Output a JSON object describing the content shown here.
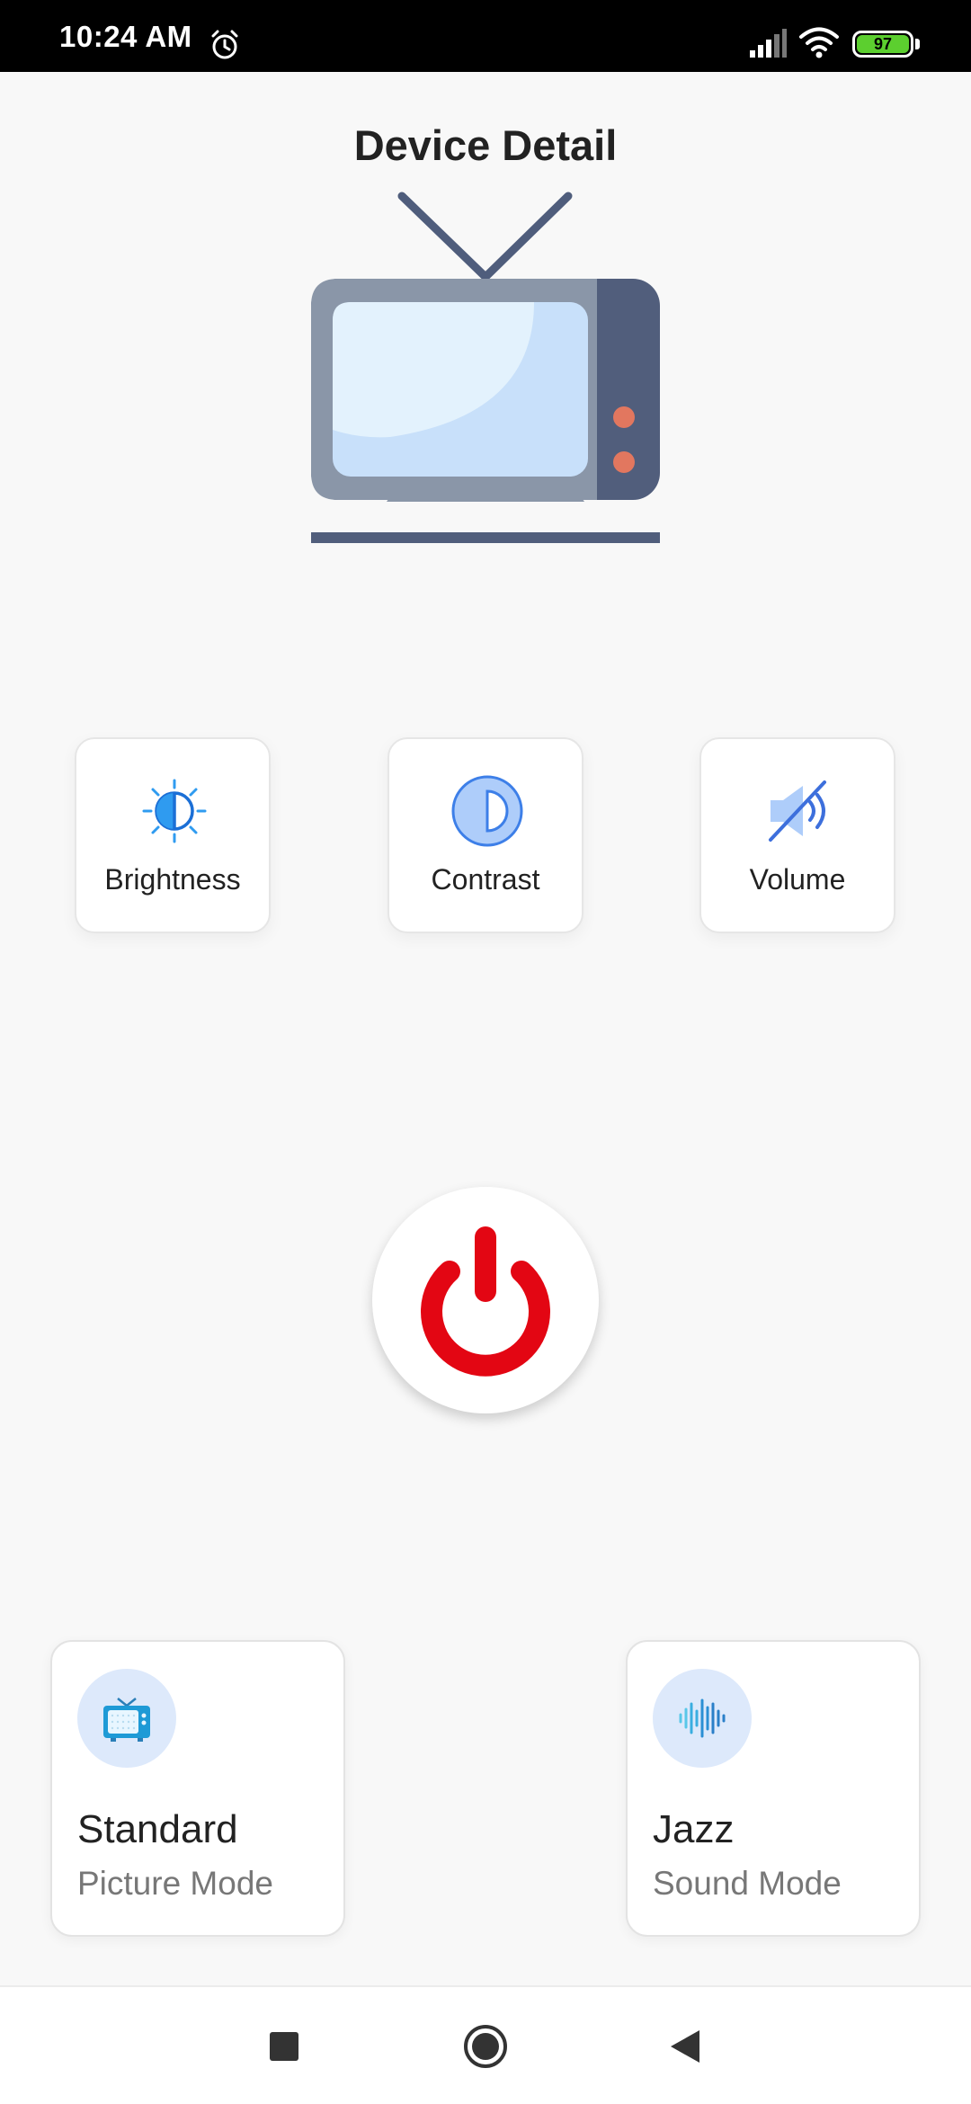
{
  "status_bar": {
    "time": "10:24 AM",
    "battery_level": "97",
    "icons": [
      "alarm-icon",
      "signal-icon",
      "wifi-icon",
      "battery-icon"
    ]
  },
  "header": {
    "title": "Device Detail"
  },
  "device": {
    "illustration_icon": "tv-icon"
  },
  "controls": [
    {
      "label": "Brightness",
      "icon": "brightness-icon"
    },
    {
      "label": "Contrast",
      "icon": "contrast-icon"
    },
    {
      "label": "Volume",
      "icon": "volume-muted-icon"
    }
  ],
  "power": {
    "icon": "power-icon",
    "color": "#e30613"
  },
  "modes": {
    "picture": {
      "value": "Standard",
      "label": "Picture Mode",
      "icon": "tv-mode-icon"
    },
    "sound": {
      "value": "Jazz",
      "label": "Sound Mode",
      "icon": "sound-wave-icon"
    }
  },
  "nav_bar": {
    "icons": [
      "recents-icon",
      "home-icon",
      "back-icon"
    ]
  },
  "colors": {
    "accent_blue": "#3d6fdc",
    "icon_bg": "#dde9fb",
    "power_red": "#e30613"
  }
}
